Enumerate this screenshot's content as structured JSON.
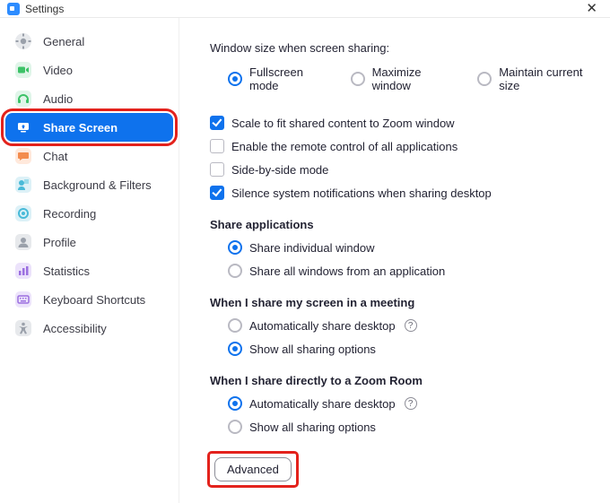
{
  "window": {
    "title": "Settings"
  },
  "sidebar": {
    "items": [
      {
        "label": "General"
      },
      {
        "label": "Video"
      },
      {
        "label": "Audio"
      },
      {
        "label": "Share Screen"
      },
      {
        "label": "Chat"
      },
      {
        "label": "Background & Filters"
      },
      {
        "label": "Recording"
      },
      {
        "label": "Profile"
      },
      {
        "label": "Statistics"
      },
      {
        "label": "Keyboard Shortcuts"
      },
      {
        "label": "Accessibility"
      }
    ]
  },
  "content": {
    "window_size_label": "Window size when screen sharing:",
    "ws_fullscreen": "Fullscreen mode",
    "ws_maximize": "Maximize window",
    "ws_maintain": "Maintain current size",
    "cb_scale": "Scale to fit shared content to Zoom window",
    "cb_remote": "Enable the remote control of all applications",
    "cb_sidebyside": "Side-by-side mode",
    "cb_silence": "Silence system notifications when sharing desktop",
    "share_apps_title": "Share applications",
    "sa_individual": "Share individual window",
    "sa_allfrom": "Share all windows from an application",
    "meeting_title": "When I share my screen in a meeting",
    "m_auto": "Automatically share desktop",
    "m_showall": "Show all sharing options",
    "zoomroom_title": "When I share directly to a Zoom Room",
    "zr_auto": "Automatically share desktop",
    "zr_showall": "Show all sharing options",
    "advanced_btn": "Advanced",
    "help_glyph": "?"
  },
  "state": {
    "window_size": "fullscreen",
    "cb_scale": true,
    "cb_remote": false,
    "cb_sidebyside": false,
    "cb_silence": true,
    "share_apps": "individual",
    "meeting": "show_all",
    "zoomroom": "auto"
  }
}
